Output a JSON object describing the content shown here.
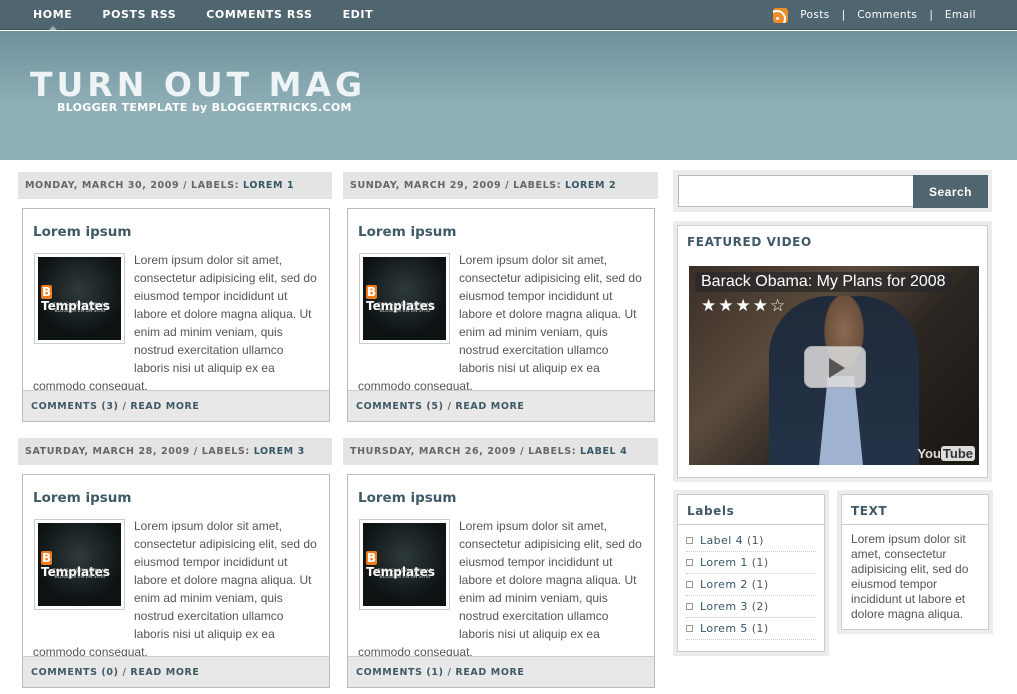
{
  "nav": {
    "items": [
      "HOME",
      "POSTS RSS",
      "COMMENTS RSS",
      "EDIT"
    ],
    "right_links": [
      "Posts",
      "Comments",
      "Email"
    ],
    "separator": "|"
  },
  "header": {
    "title": "TURN OUT MAG",
    "subtitle": "BLOGGER TEMPLATE by BLOGGERTRICKS.COM"
  },
  "posts": [
    {
      "date": "MONDAY, MARCH 30, 2009",
      "labels_prefix": " / LABELS: ",
      "label": "LOREM 1",
      "title": "Lorem ipsum",
      "body": "Lorem ipsum dolor sit amet, consectetur adipisicing elit, sed do eiusmod tempor incididunt ut labore et dolore magna aliqua. Ut enim ad minim veniam, quis nostrud exercitation ullamco laboris nisi ut aliquip ex ea commodo consequat.",
      "comments": "COMMENTS (3)",
      "read_more": "READ MORE"
    },
    {
      "date": "SUNDAY, MARCH 29, 2009",
      "labels_prefix": " / LABELS: ",
      "label": "LOREM 2",
      "title": "Lorem ipsum",
      "body": "Lorem ipsum dolor sit amet, consectetur adipisicing elit, sed do eiusmod tempor incididunt ut labore et dolore magna aliqua. Ut enim ad minim veniam, quis nostrud exercitation ullamco laboris nisi ut aliquip ex ea commodo consequat.",
      "comments": "COMMENTS (5)",
      "read_more": "READ MORE"
    },
    {
      "date": "SATURDAY, MARCH 28, 2009",
      "labels_prefix": " / LABELS: ",
      "label": "LOREM 3",
      "title": "Lorem ipsum",
      "body": "Lorem ipsum dolor sit amet, consectetur adipisicing elit, sed do eiusmod tempor incididunt ut labore et dolore magna aliqua. Ut enim ad minim veniam, quis nostrud exercitation ullamco laboris nisi ut aliquip ex ea commodo consequat.",
      "comments": "COMMENTS (0)",
      "read_more": "READ MORE"
    },
    {
      "date": "THURSDAY, MARCH 26, 2009",
      "labels_prefix": " / LABELS: ",
      "label": "LABEL 4",
      "title": "Lorem ipsum",
      "body": "Lorem ipsum dolor sit amet, consectetur adipisicing elit, sed do eiusmod tempor incididunt ut labore et dolore magna aliqua. Ut enim ad minim veniam, quis nostrud exercitation ullamco laboris nisi ut aliquip ex ea commodo consequat.",
      "comments": "COMMENTS (1)",
      "read_more": "READ MORE"
    }
  ],
  "thumbnail": {
    "logo_letter": "B",
    "logo_text": "Templates",
    "tagline": "TODAS LAS PLANTILLAS BLOGGER EN UN SITIO"
  },
  "sidebar": {
    "search": {
      "button": "Search",
      "placeholder": ""
    },
    "featured_video": {
      "title": "FEATURED VIDEO",
      "video_title": "Barack Obama: My Plans for 2008",
      "stars": "★★★★☆",
      "rating": 4,
      "brand_a": "You",
      "brand_b": "Tube"
    },
    "labels": {
      "title": "Labels",
      "items": [
        {
          "name": "Label 4",
          "count": "(1)"
        },
        {
          "name": "Lorem 1",
          "count": "(1)"
        },
        {
          "name": "Lorem 2",
          "count": "(1)"
        },
        {
          "name": "Lorem 3",
          "count": "(2)"
        },
        {
          "name": "Lorem 5",
          "count": "(1)"
        }
      ]
    },
    "text_widget": {
      "title": "TEXT",
      "body": "Lorem ipsum dolor sit amet, consectetur adipisicing elit, sed do eiusmod tempor incididunt ut labore et dolore magna aliqua."
    }
  },
  "colors": {
    "nav_bg": "#4f6570",
    "header_bg": "#8fb0b7",
    "accent": "#3f5a66",
    "rss": "#f08c2a"
  }
}
